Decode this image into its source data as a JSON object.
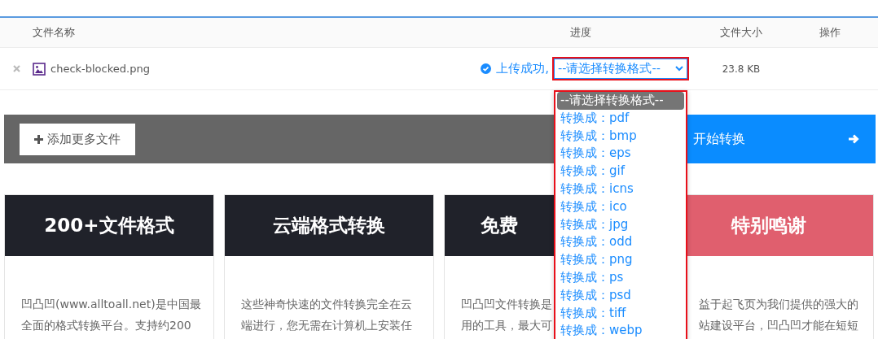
{
  "table": {
    "columns": [
      "文件名称",
      "进度",
      "文件大小",
      "操作"
    ],
    "rows": [
      {
        "name": "check-blocked.png",
        "status": "上传成功,",
        "size": "23.8 KB",
        "format_select": {
          "value": "--请选择转换格式--",
          "expanded": true,
          "options": [
            {
              "label": "--请选择转换格式--",
              "selected": true
            },
            {
              "label": "转换成：pdf",
              "selected": false
            },
            {
              "label": "转换成：bmp",
              "selected": false
            },
            {
              "label": "转换成：eps",
              "selected": false
            },
            {
              "label": "转换成：gif",
              "selected": false
            },
            {
              "label": "转换成：icns",
              "selected": false
            },
            {
              "label": "转换成：ico",
              "selected": false
            },
            {
              "label": "转换成：jpg",
              "selected": false
            },
            {
              "label": "转换成：odd",
              "selected": false
            },
            {
              "label": "转换成：png",
              "selected": false
            },
            {
              "label": "转换成：ps",
              "selected": false
            },
            {
              "label": "转换成：psd",
              "selected": false
            },
            {
              "label": "转换成：tiff",
              "selected": false
            },
            {
              "label": "转换成：webp",
              "selected": false
            }
          ]
        }
      }
    ]
  },
  "actions": {
    "add_files": "添加更多文件",
    "start": "开始转换"
  },
  "cards": [
    {
      "title": "200+文件格式",
      "color": "#20222a",
      "clipped_left": false,
      "clipped_right": false,
      "lines": [
        "凹凸凹(www.alltoall.net)是中国最",
        "全面的格式转换平台。支持约200"
      ]
    },
    {
      "title": "云端格式转换",
      "color": "#20222a",
      "clipped_left": false,
      "clipped_right": false,
      "lines": [
        "这些神奇快速的文件转换完全在云",
        "端进行，您无需在计算机上安装任"
      ]
    },
    {
      "title": "免费",
      "color": "#20222a",
      "clipped_left": false,
      "clipped_right": true,
      "lines": [
        "凹凸凹文件转换是",
        "用的工具，最大可"
      ]
    },
    {
      "title": "特别鸣谢",
      "color": "#e05f6e",
      "clipped_left": true,
      "clipped_right": false,
      "lines": [
        "益于起飞页为我们提供的强大的",
        "站建设平台，凹凸凹才能在短短"
      ]
    }
  ]
}
